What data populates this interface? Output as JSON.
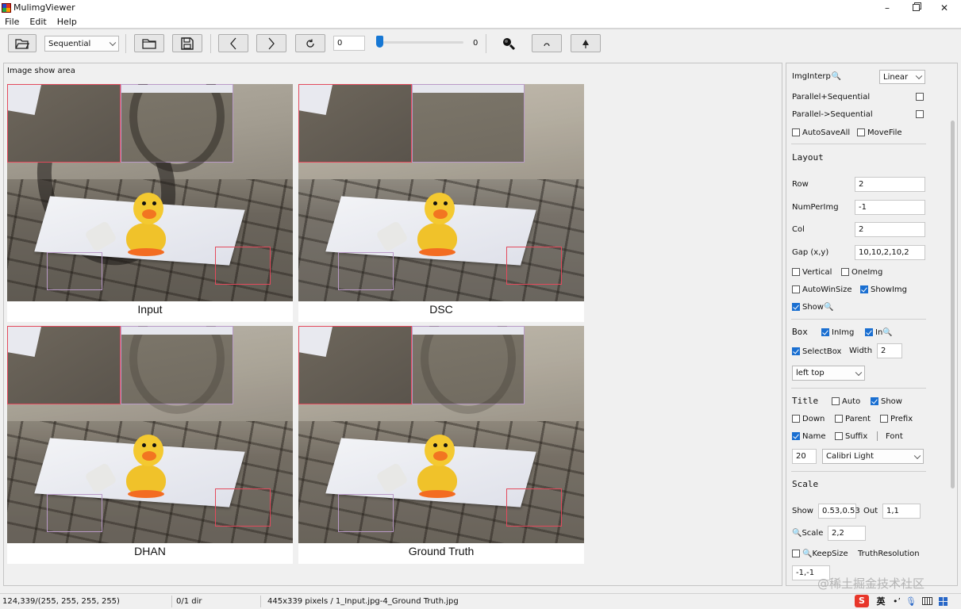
{
  "window": {
    "title": "MulimgViewer"
  },
  "menu": [
    "File",
    "Edit",
    "Help"
  ],
  "toolbar": {
    "mode_value": "Sequential",
    "index_value": "0",
    "slider_value": 0,
    "slider_max_label": "0"
  },
  "main": {
    "area_label": "Image show area",
    "tiles": [
      {
        "title": "Input"
      },
      {
        "title": "DSC"
      },
      {
        "title": "DHAN"
      },
      {
        "title": "Ground Truth"
      }
    ]
  },
  "panel": {
    "img_interp_label": "ImgInterp",
    "img_interp_value": "Linear",
    "parallel_sequential": {
      "label": "Parallel+Sequential",
      "checked": false
    },
    "parallel_to_sequential": {
      "label": "Parallel->Sequential",
      "checked": false
    },
    "auto_save_all": {
      "label": "AutoSaveAll",
      "checked": false
    },
    "move_file": {
      "label": "MoveFile",
      "checked": false
    },
    "layout": {
      "title": "Layout",
      "row_label": "Row",
      "row_value": "2",
      "num_per_img_label": "NumPerImg",
      "num_per_img_value": "-1",
      "col_label": "Col",
      "col_value": "2",
      "gap_label": "Gap (x,y)",
      "gap_value": "10,10,2,10,2",
      "vertical": {
        "label": "Vertical",
        "checked": false
      },
      "one_img": {
        "label": "OneImg",
        "checked": false
      },
      "auto_win_size": {
        "label": "AutoWinSize",
        "checked": false
      },
      "show_img": {
        "label": "ShowImg",
        "checked": true
      },
      "show_zoom": {
        "label": "Show",
        "checked": true
      }
    },
    "box": {
      "title": "Box",
      "in_img": {
        "label": "InImg",
        "checked": true
      },
      "in_zoom": {
        "label": "In",
        "checked": true
      },
      "select_box": {
        "label": "SelectBox",
        "checked": true
      },
      "width_label": "Width",
      "width_value": "2",
      "position_value": "left top"
    },
    "title_section": {
      "title": "Title",
      "auto": {
        "label": "Auto",
        "checked": false
      },
      "show": {
        "label": "Show",
        "checked": true
      },
      "down": {
        "label": "Down",
        "checked": false
      },
      "parent": {
        "label": "Parent",
        "checked": false
      },
      "prefix": {
        "label": "Prefix",
        "checked": false
      },
      "name": {
        "label": "Name",
        "checked": true
      },
      "suffix": {
        "label": "Suffix",
        "checked": false
      },
      "font_label": "Font",
      "font_size_value": "20",
      "font_value": "Calibri Light"
    },
    "scale": {
      "title": "Scale",
      "show_label": "Show",
      "show_value": "0.53,0.53",
      "out_label": "Out",
      "out_value": "1,1",
      "zoom_scale_label": "Scale",
      "zoom_scale_value": "2,2",
      "keep_size": {
        "label": "KeepSize",
        "checked": false
      },
      "truth_resolution_label": "TruthResolution",
      "truth_resolution_value": "-1,-1"
    }
  },
  "status": {
    "pixel": "124,339/(255, 255, 255, 255)",
    "dir": "0/1 dir",
    "info": "445x339 pixels / 1_Input.jpg-4_Ground Truth.jpg"
  },
  "watermark": "@稀土掘金技术社区",
  "tray": {
    "ime": "英"
  },
  "colors": {
    "accent": "#1a6fd1",
    "box_red": "#e34a5c",
    "box_purple": "#b99ac7"
  }
}
